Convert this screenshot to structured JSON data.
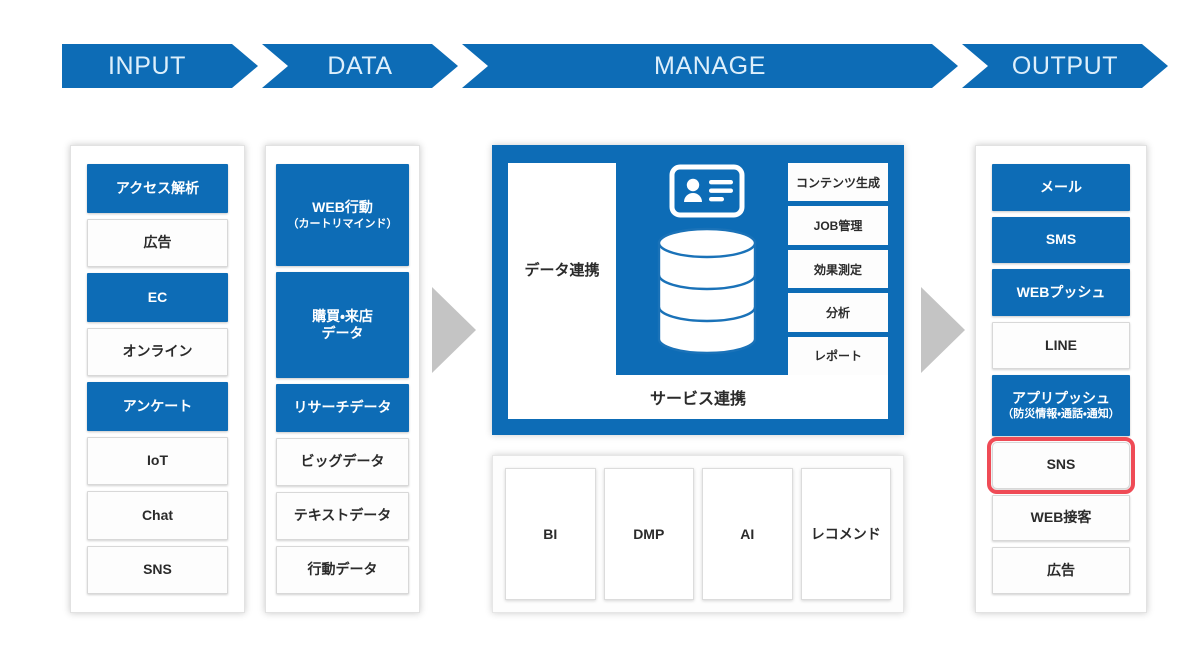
{
  "header": {
    "stages": [
      {
        "label": "INPUT",
        "icon": "chevron-right-icon"
      },
      {
        "label": "DATA",
        "icon": "chevron-right-icon"
      },
      {
        "label": "MANAGE",
        "icon": "chevron-right-icon"
      },
      {
        "label": "OUTPUT",
        "icon": "chevron-right-icon"
      }
    ]
  },
  "colors": {
    "brand_blue": "#0d6cb6",
    "chip_white": "#fdfdfd",
    "arrow_gray": "#c4c4c4",
    "highlight_red": "#ef4b56",
    "text_dark": "#2b2b2b"
  },
  "input_column": {
    "items": [
      {
        "label": "アクセス解析",
        "style": "blue"
      },
      {
        "label": "広告",
        "style": "white"
      },
      {
        "label": "EC",
        "style": "blue"
      },
      {
        "label": "オンライン",
        "style": "white"
      },
      {
        "label": "アンケート",
        "style": "blue"
      },
      {
        "label": "IoT",
        "style": "white"
      },
      {
        "label": "Chat",
        "style": "white"
      },
      {
        "label": "SNS",
        "style": "white"
      }
    ]
  },
  "data_column": {
    "items": [
      {
        "label": "WEB行動",
        "sub": "（カートリマインド）",
        "style": "blue",
        "grow": 2.4
      },
      {
        "label": "購買・来店\nデータ",
        "sub": "",
        "style": "blue",
        "grow": 2.4
      },
      {
        "label": "リサーチデータ",
        "sub": "",
        "style": "blue",
        "grow": 1
      },
      {
        "label": "ビッグデータ",
        "sub": "",
        "style": "white",
        "grow": 1
      },
      {
        "label": "テキストデータ",
        "sub": "",
        "style": "white",
        "grow": 1
      },
      {
        "label": "行動データ",
        "sub": "",
        "style": "white",
        "grow": 1
      }
    ]
  },
  "manage": {
    "data_linkage_label": "データ連携",
    "service_linkage_label": "サービス連携",
    "icons": [
      {
        "name": "id-card-icon"
      },
      {
        "name": "database-icon"
      }
    ],
    "side_items": [
      {
        "label": "コンテンツ生成"
      },
      {
        "label": "JOB管理"
      },
      {
        "label": "効果測定"
      },
      {
        "label": "分析"
      },
      {
        "label": "レポート"
      }
    ],
    "tools": [
      {
        "label": "BI"
      },
      {
        "label": "DMP"
      },
      {
        "label": "AI"
      },
      {
        "label": "レコメンド"
      }
    ]
  },
  "output_column": {
    "items": [
      {
        "label": "メール",
        "sub": "",
        "style": "blue",
        "highlight": false
      },
      {
        "label": "SMS",
        "sub": "",
        "style": "blue",
        "highlight": false
      },
      {
        "label": "WEBプッシュ",
        "sub": "",
        "style": "blue",
        "highlight": false
      },
      {
        "label": "LINE",
        "sub": "",
        "style": "white",
        "highlight": false
      },
      {
        "label": "アプリプッシュ",
        "sub": "（防災情報・通話・通知）",
        "style": "blue",
        "highlight": false
      },
      {
        "label": "SNS",
        "sub": "",
        "style": "white",
        "highlight": true
      },
      {
        "label": "WEB接客",
        "sub": "",
        "style": "white",
        "highlight": false
      },
      {
        "label": "広告",
        "sub": "",
        "style": "white",
        "highlight": false
      }
    ]
  },
  "flow_arrows": [
    {
      "name": "flow-arrow-data-to-manage"
    },
    {
      "name": "flow-arrow-manage-to-output"
    }
  ]
}
